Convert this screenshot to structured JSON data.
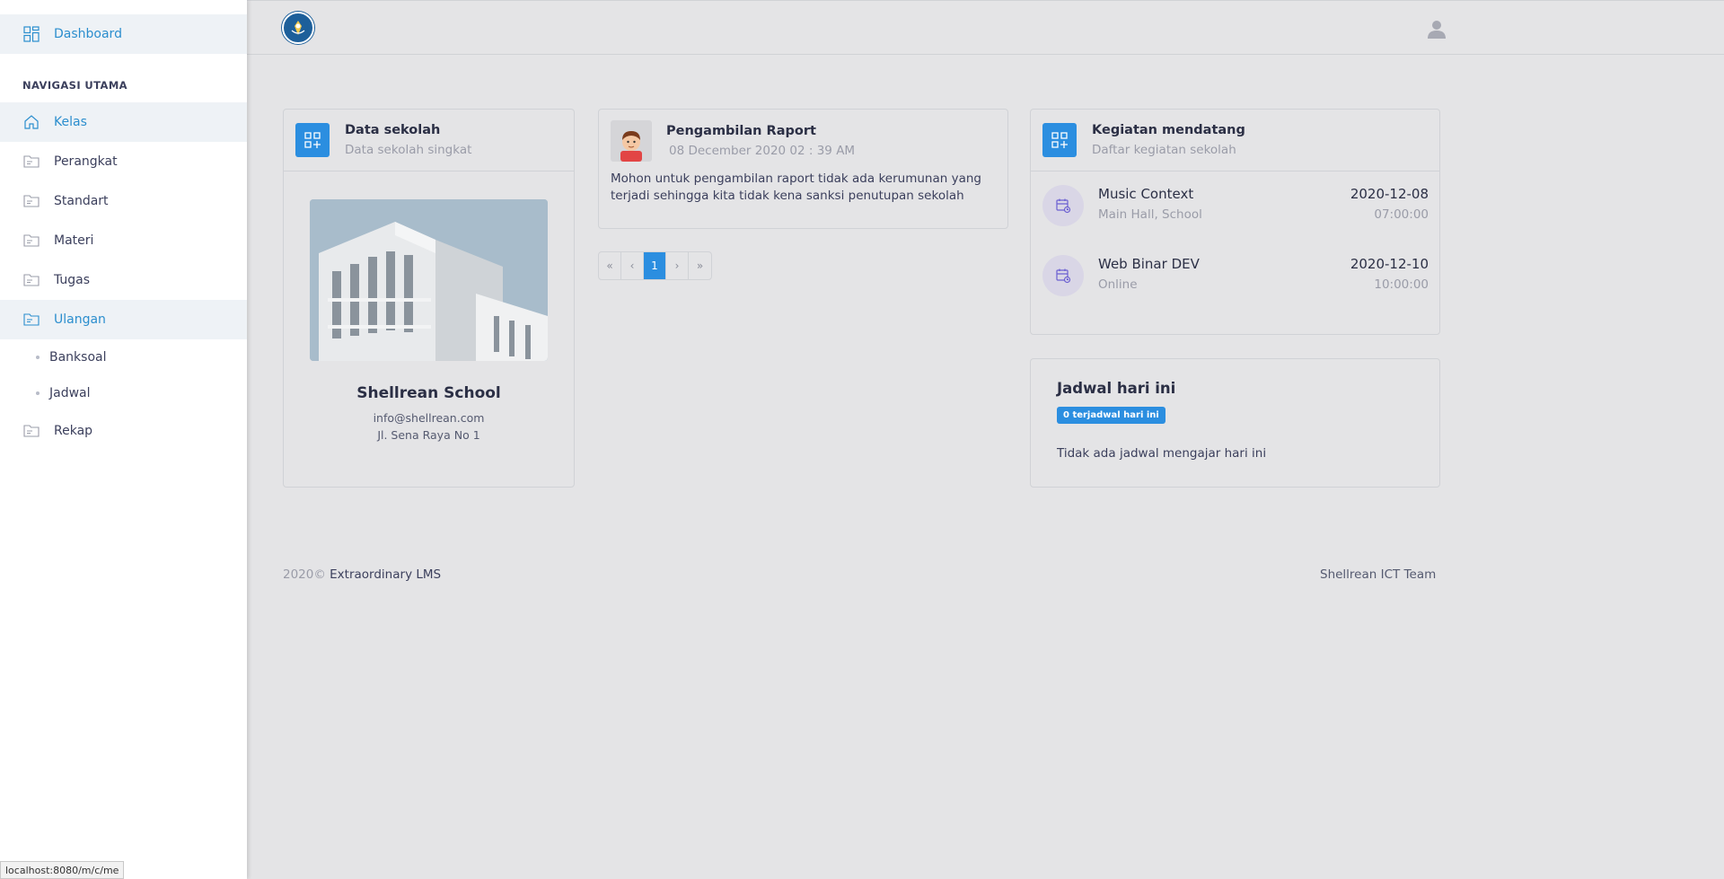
{
  "sidebar": {
    "dashboard": "Dashboard",
    "section_heading": "NAVIGASI UTAMA",
    "items": [
      {
        "label": "Kelas",
        "icon": "home-icon",
        "active": true
      },
      {
        "label": "Perangkat",
        "icon": "folder-icon"
      },
      {
        "label": "Standart",
        "icon": "folder-icon"
      },
      {
        "label": "Materi",
        "icon": "folder-icon"
      },
      {
        "label": "Tugas",
        "icon": "folder-icon"
      },
      {
        "label": "Ulangan",
        "icon": "folder-icon",
        "active": true
      }
    ],
    "subitems": [
      "Banksoal",
      "Jadwal"
    ],
    "last_item": {
      "label": "Rekap",
      "icon": "folder-icon"
    }
  },
  "topbar": {
    "logo_icon": "school-logo",
    "user_icon": "user-icon"
  },
  "school_card": {
    "title": "Data sekolah",
    "subtitle": "Data sekolah singkat",
    "name": "Shellrean School",
    "email": "info@shellrean.com",
    "address": "Jl. Sena Raya No 1"
  },
  "announcement": {
    "title": "Pengambilan Raport",
    "date": "08 December 2020 02 : 39 AM",
    "body": "Mohon untuk pengambilan raport tidak ada kerumunan yang terjadi sehingga kita tidak kena sanksi penutupan sekolah"
  },
  "pagination": {
    "first": "«",
    "prev": "‹",
    "current": "1",
    "next": "›",
    "last": "»"
  },
  "events_card": {
    "title": "Kegiatan mendatang",
    "subtitle": "Daftar kegiatan sekolah",
    "events": [
      {
        "name": "Music Context",
        "location": "Main Hall, School",
        "date": "2020-12-08",
        "time": "07:00:00"
      },
      {
        "name": "Web Binar DEV",
        "location": "Online",
        "date": "2020-12-10",
        "time": "10:00:00"
      }
    ]
  },
  "schedule_card": {
    "title": "Jadwal hari ini",
    "badge": "0 terjadwal hari ini",
    "empty_text": "Tidak ada jadwal mengajar hari ini"
  },
  "footer": {
    "year": "2020©",
    "product": "Extraordinary LMS",
    "team": "Shellrean ICT Team"
  },
  "status_url": "localhost:8080/m/c/me",
  "colors": {
    "accent": "#2b8ee0",
    "active_link": "#2b8ece",
    "background": "#e4e4e6"
  }
}
